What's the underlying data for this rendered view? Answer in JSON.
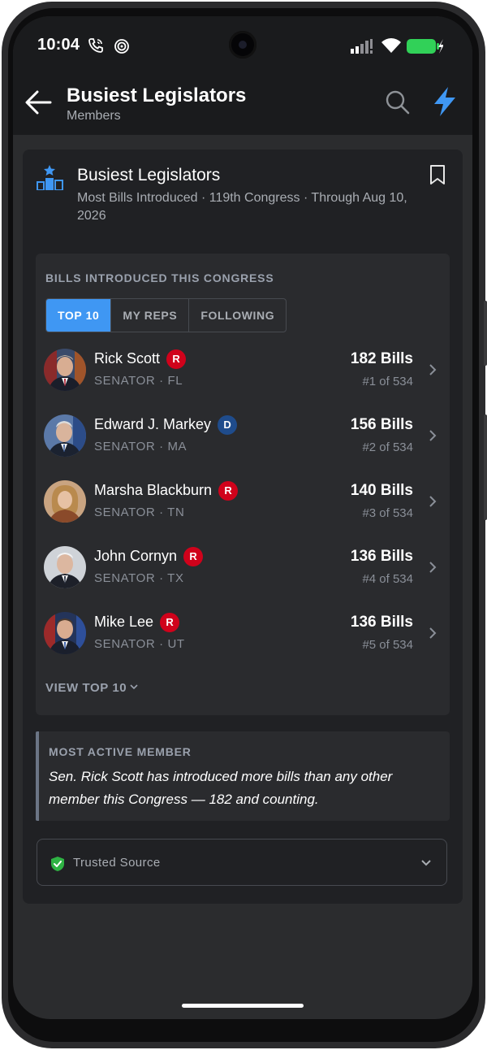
{
  "status_bar": {
    "time": "10:04"
  },
  "app_bar": {
    "title": "Busiest Legislators",
    "subtitle": "Members"
  },
  "card": {
    "title": "Busiest Legislators",
    "subtitle": "Most Bills Introduced · 119th Congress · Through Aug 10, 2026"
  },
  "panel": {
    "section_label": "BILLS INTRODUCED THIS CONGRESS",
    "tabs": [
      {
        "label": "TOP 10",
        "active": true
      },
      {
        "label": "MY REPS",
        "active": false
      },
      {
        "label": "FOLLOWING",
        "active": false
      }
    ],
    "members": [
      {
        "name": "Rick Scott",
        "party": "R",
        "role": "SENATOR · FL",
        "bills": "182 Bills",
        "rank": "#1 of 534"
      },
      {
        "name": "Edward J. Markey",
        "party": "D",
        "role": "SENATOR · MA",
        "bills": "156 Bills",
        "rank": "#2 of 534"
      },
      {
        "name": "Marsha Blackburn",
        "party": "R",
        "role": "SENATOR · TN",
        "bills": "140 Bills",
        "rank": "#3 of 534"
      },
      {
        "name": "John Cornyn",
        "party": "R",
        "role": "SENATOR · TX",
        "bills": "136 Bills",
        "rank": "#4 of 534"
      },
      {
        "name": "Mike Lee",
        "party": "R",
        "role": "SENATOR · UT",
        "bills": "136 Bills",
        "rank": "#5 of 534"
      }
    ],
    "view_more_label": "VIEW TOP 10"
  },
  "highlight": {
    "heading": "MOST ACTIVE MEMBER",
    "text": "Sen. Rick Scott has introduced more bills than any other member this Congress — 182 and counting."
  },
  "source": {
    "label": "Trusted Source"
  },
  "colors": {
    "accent": "#3f97f3",
    "republican": "#d0021b",
    "democrat": "#1f4c8c",
    "verified": "#2fb344",
    "battery": "#31d158"
  },
  "icons": [
    "back-arrow-icon",
    "search-icon",
    "lightning-bolt-icon",
    "leaderboard-icon",
    "bookmark-icon",
    "chevron-right-icon",
    "chevron-down-icon",
    "shield-check-icon",
    "wifi-icon",
    "signal-icon",
    "battery-icon",
    "phone-call-icon",
    "hotspot-icon"
  ]
}
